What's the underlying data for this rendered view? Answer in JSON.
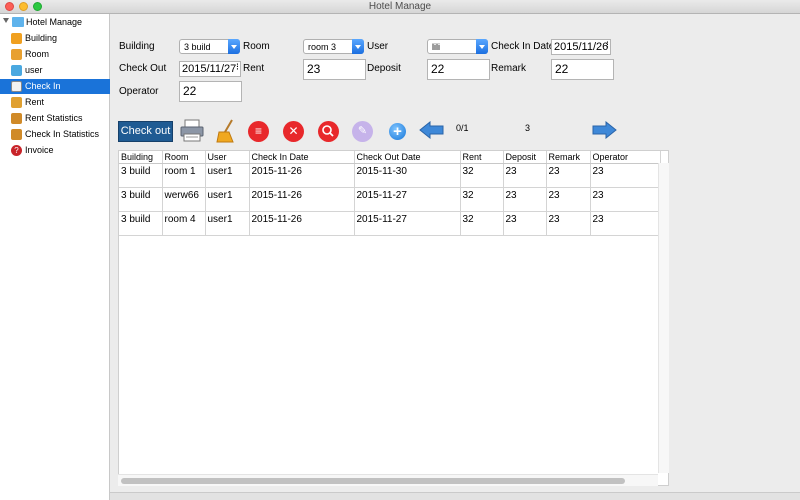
{
  "window": {
    "title": "Hotel Manage"
  },
  "sidebar": {
    "root_label": "Hotel Manage",
    "items": [
      {
        "label": "Building",
        "icon": "building-icon",
        "color": "#f0a020",
        "selected": false
      },
      {
        "label": "Room",
        "icon": "house-icon",
        "color": "#e8a030",
        "selected": false
      },
      {
        "label": "user",
        "icon": "user-cube-icon",
        "color": "#4aa8e0",
        "selected": false
      },
      {
        "label": "Check In",
        "icon": "checkin-clipboard-icon",
        "color": "#f2f2f2",
        "selected": true
      },
      {
        "label": "Rent",
        "icon": "rent-icon",
        "color": "#e0a030",
        "selected": false
      },
      {
        "label": "Rent Statistics",
        "icon": "rent-statistics-icon",
        "color": "#d08a28",
        "selected": false
      },
      {
        "label": "Check In Statistics",
        "icon": "checkin-statistics-icon",
        "color": "#d08a28",
        "selected": false
      },
      {
        "label": "Invoice",
        "icon": "question-icon",
        "color": "#c8242a",
        "selected": false
      }
    ]
  },
  "form": {
    "building_label": "Building",
    "building_value": "3  build",
    "room_label": "Room",
    "room_value": "room 3",
    "user_label": "User",
    "user_value": "lili",
    "checkin_date_label": "Check In Date",
    "checkin_date_value": "2015/11/26",
    "checkout_label": "Check Out",
    "checkout_value": "2015/11/27",
    "rent_label": "Rent",
    "rent_value": "23",
    "deposit_label": "Deposit",
    "deposit_value": "22",
    "remark_label": "Remark",
    "remark_value": "22",
    "operator_label": "Operator",
    "operator_value": "22"
  },
  "toolbar": {
    "checkout_button": "Check out",
    "page_indicator": "0/1",
    "total_count": "3",
    "accent_color": "#1f5b93"
  },
  "table": {
    "columns": [
      "Building",
      "Room",
      "User",
      "Check In Date",
      "Check Out Date",
      "Rent",
      "Deposit",
      "Remark",
      "Operator"
    ],
    "rows": [
      [
        "3  build",
        "room 1",
        "user1",
        "2015-11-26",
        "2015-11-30",
        "32",
        "23",
        "23",
        "23"
      ],
      [
        "3  build",
        "werw66",
        "user1",
        "2015-11-26",
        "2015-11-27",
        "32",
        "23",
        "23",
        "23"
      ],
      [
        "3  build",
        "room 4",
        "user1",
        "2015-11-26",
        "2015-11-27",
        "32",
        "23",
        "23",
        "23"
      ]
    ]
  }
}
